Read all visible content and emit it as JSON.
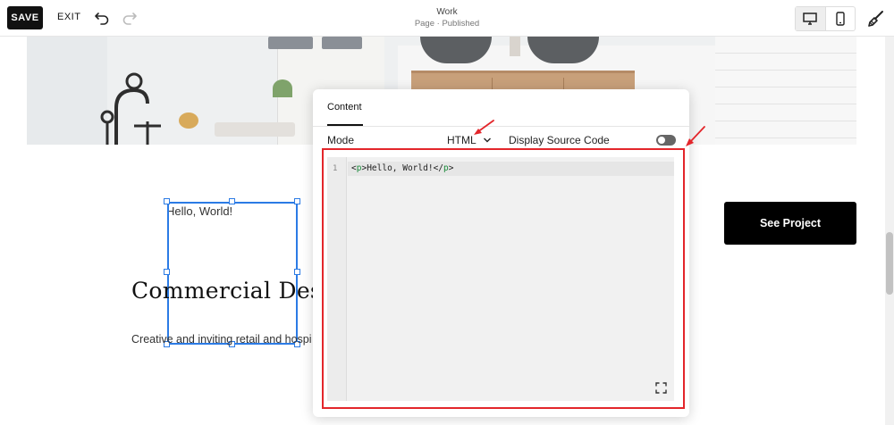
{
  "toolbar": {
    "save_label": "SAVE",
    "exit_label": "EXIT",
    "undo_icon": "undo-icon",
    "redo_icon": "redo-icon",
    "page_title": "Work",
    "page_status": "Page · Published",
    "desktop_icon": "desktop-icon",
    "mobile_icon": "mobile-icon",
    "design_icon": "paintbrush-icon"
  },
  "canvas": {
    "text_block": "Hello, World!",
    "heading": "Commercial Desig",
    "subtext": "Creative and inviting retail and hospi",
    "cta_label": "See Project"
  },
  "panel": {
    "tab_label": "Content",
    "mode_label": "Mode",
    "mode_value": "HTML",
    "display_source_label": "Display Source Code",
    "display_source_enabled": false,
    "code": {
      "line_number": "1",
      "open_tag_lt": "<",
      "open_tag_name": "p",
      "open_tag_gt": ">",
      "text": "Hello, World!",
      "close_tag_lt": "</",
      "close_tag_name": "p",
      "close_tag_gt": ">"
    },
    "expand_icon": "expand-icon"
  },
  "colors": {
    "accent_selection": "#2b7be5",
    "annotation_red": "#e3262b",
    "button_dark": "#000000"
  }
}
